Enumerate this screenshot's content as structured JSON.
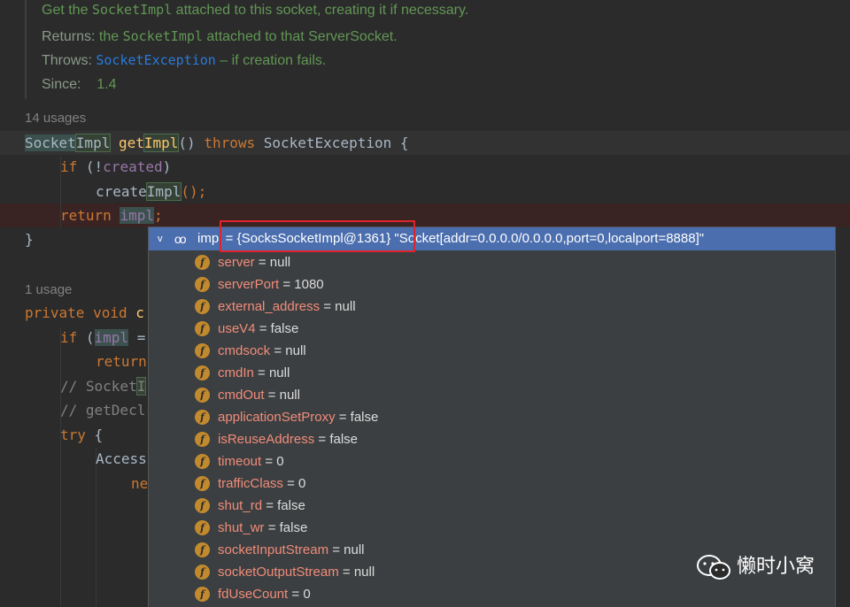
{
  "doc": {
    "summary_pre": "Get the ",
    "summary_code": "SocketImpl",
    "summary_post": " attached to this socket, creating it if necessary.",
    "returns_label": "Returns:",
    "returns_pre": " the ",
    "returns_code": "SocketImpl",
    "returns_post": " attached to that ServerSocket.",
    "throws_label": "Throws:",
    "throws_link": "SocketException",
    "throws_post": " – if creation fails.",
    "since_label": "Since:",
    "since_value": "1.4"
  },
  "usages_1": "14 usages",
  "usages_2": "1 usage",
  "code": {
    "l1_type_a": "Socket",
    "l1_type_b": "Impl",
    "l1_fn_a": "get",
    "l1_fn_b": "Impl",
    "l1_parens": "() ",
    "l1_throws": "throws",
    "l1_exc": " SocketException {",
    "l2_if": "if",
    "l2_rest_a": " (!",
    "l2_field": "created",
    "l2_rest_b": ")",
    "l3_call_a": "create",
    "l3_call_b": "Impl",
    "l3_rest": "();",
    "l4_return": "return",
    "l4_var": "impl",
    "l4_semi": ";",
    "l5": "}",
    "l6_private": "private",
    "l6_void": " void",
    "l6_c": " c",
    "l7_if": "if",
    "l7_open": " (",
    "l7_var": "impl",
    "l7_eq": " =",
    "l8_return": "return",
    "l9_comment": "// Socket",
    "l9_hl": "I",
    "l10_comment": "// getDecl",
    "l11_try": "try",
    "l11_brace": " {",
    "l12": "Access",
    "l13": "ne"
  },
  "popup": {
    "arrow": "v",
    "glasses": "oo",
    "header_text": "impl = {SocksSocketImpl@1361} \"Socket[addr=0.0.0.0/0.0.0.0,port=0,localport=8888]\"",
    "fields": [
      {
        "name": "server",
        "value": " = null"
      },
      {
        "name": "serverPort",
        "value": " = 1080"
      },
      {
        "name": "external_address",
        "value": " = null"
      },
      {
        "name": "useV4",
        "value": " = false"
      },
      {
        "name": "cmdsock",
        "value": " = null"
      },
      {
        "name": "cmdIn",
        "value": " = null"
      },
      {
        "name": "cmdOut",
        "value": " = null"
      },
      {
        "name": "applicationSetProxy",
        "value": " = false"
      },
      {
        "name": "isReuseAddress",
        "value": " = false"
      },
      {
        "name": "timeout",
        "value": " = 0"
      },
      {
        "name": "trafficClass",
        "value": " = 0"
      },
      {
        "name": "shut_rd",
        "value": " = false"
      },
      {
        "name": "shut_wr",
        "value": " = false"
      },
      {
        "name": "socketInputStream",
        "value": " = null"
      },
      {
        "name": "socketOutputStream",
        "value": " = null"
      },
      {
        "name": "fdUseCount",
        "value": " = 0"
      }
    ],
    "field_icon": "f"
  },
  "watermark": "懒时小窝",
  "colors": {
    "background": "#2b2b2b",
    "keyword": "#cc7832",
    "function": "#ffc66d",
    "field": "#9876aa",
    "doc": "#629755",
    "popup_header": "#4b6eaf",
    "field_name": "#f08c7a",
    "highlight_box": "#e0242c"
  }
}
